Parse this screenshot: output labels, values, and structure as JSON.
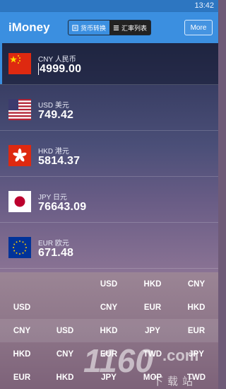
{
  "status": {
    "time": "13:42"
  },
  "app": {
    "title": "iMoney"
  },
  "toolbar": {
    "tab_convert": "货币转换",
    "tab_rates": "汇率列表",
    "more": "More"
  },
  "currencies": [
    {
      "code": "CNY 人民币",
      "value": "4999.00",
      "flag": "china-flag",
      "selected": true
    },
    {
      "code": "USD 美元",
      "value": "749.42",
      "flag": "us-flag"
    },
    {
      "code": "HKD 港元",
      "value": "5814.37",
      "flag": "hong-kong-flag"
    },
    {
      "code": "JPY 日元",
      "value": "76643.09",
      "flag": "japan-flag"
    },
    {
      "code": "EUR 欧元",
      "value": "671.48",
      "flag": "eu-flag"
    }
  ],
  "picker": {
    "rows": [
      [
        "",
        "",
        "USD",
        "HKD",
        "CNY"
      ],
      [
        "USD",
        "",
        "CNY",
        "EUR",
        "HKD"
      ],
      [
        "CNY",
        "USD",
        "HKD",
        "JPY",
        "EUR"
      ],
      [
        "HKD",
        "CNY",
        "EUR",
        "TWD",
        "JPY"
      ],
      [
        "EUR",
        "HKD",
        "JPY",
        "MOP",
        "TWD"
      ]
    ]
  },
  "watermark": {
    "brand": "1160",
    "domain": ".com",
    "sub": "下载站"
  },
  "colors": {
    "accent": "#3b8fe0",
    "statusbar": "#2d76c1"
  }
}
